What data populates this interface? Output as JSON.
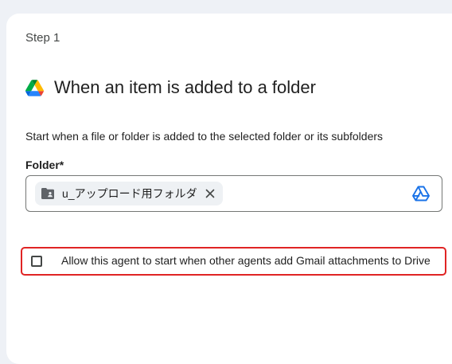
{
  "step": {
    "label": "Step 1"
  },
  "trigger": {
    "icon": "google-drive-icon",
    "title": "When an item is added to a folder",
    "description": "Start when a file or folder is added to the selected folder or its subfolders"
  },
  "folder": {
    "label": "Folder*",
    "selected_chip": {
      "icon": "shared-folder-icon",
      "text": "u_アップロード用フォルダ",
      "remove_icon": "close-icon"
    },
    "picker_icon": "google-drive-outline-icon"
  },
  "gmail_attachments_option": {
    "checked": false,
    "label": "Allow this agent to start when other agents add Gmail attachments to Drive"
  },
  "colors": {
    "background": "#eef1f6",
    "card": "#ffffff",
    "chip": "#eef1f4",
    "drive_blue": "#1a73e8",
    "highlight_border": "#e02424"
  }
}
